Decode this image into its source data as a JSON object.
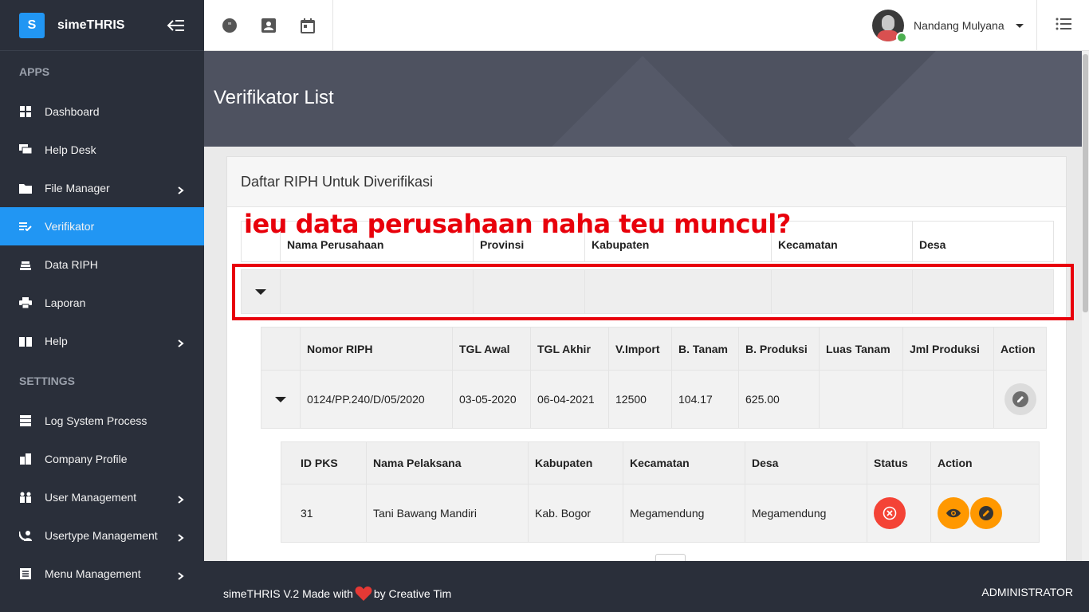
{
  "brand": {
    "logo_letter": "S",
    "name": "simeTHRIS"
  },
  "sidebar": {
    "section_apps": "APPS",
    "section_settings": "SETTINGS",
    "apps_items": [
      {
        "label": "Dashboard",
        "icon": "dashboard-icon"
      },
      {
        "label": "Help Desk",
        "icon": "chat-icon"
      },
      {
        "label": "File Manager",
        "icon": "folder-icon"
      },
      {
        "label": "Verifikator",
        "icon": "checklist-icon",
        "active": true
      },
      {
        "label": "Data RIPH",
        "icon": "stack-icon"
      },
      {
        "label": "Laporan",
        "icon": "print-icon"
      },
      {
        "label": "Help",
        "icon": "book-icon"
      }
    ],
    "settings_items": [
      {
        "label": "Log System Process",
        "icon": "storage-icon"
      },
      {
        "label": "Company Profile",
        "icon": "building-icon"
      },
      {
        "label": "User Management",
        "icon": "people-icon"
      },
      {
        "label": "Usertype Management",
        "icon": "phone-user-icon"
      },
      {
        "label": "Menu Management",
        "icon": "menu-list-icon"
      }
    ]
  },
  "topbar": {
    "user_name": "Nandang Mulyana"
  },
  "hero": {
    "title": "Verifikator List"
  },
  "card": {
    "title": "Daftar RIPH Untuk Diverifikasi",
    "outer_columns": [
      "Nama Perusahaan",
      "Provinsi",
      "Kabupaten",
      "Kecamatan",
      "Desa"
    ],
    "riph_columns": [
      "Nomor RIPH",
      "TGL Awal",
      "TGL Akhir",
      "V.Import",
      "B. Tanam",
      "B. Produksi",
      "Luas Tanam",
      "Jml Produksi",
      "Action"
    ],
    "riph_row": {
      "nomor": "0124/PP.240/D/05/2020",
      "tgl_awal": "03-05-2020",
      "tgl_akhir": "06-04-2021",
      "v_import": "12500",
      "b_tanam": "104.17",
      "b_produksi": "625.00",
      "luas_tanam": "",
      "jml_produksi": ""
    },
    "pks_columns": [
      "ID PKS",
      "Nama Pelaksana",
      "Kabupaten",
      "Kecamatan",
      "Desa",
      "Status",
      "Action"
    ],
    "pks_row": {
      "id": "31",
      "nama": "Tani Bawang Mandiri",
      "kabupaten": "Kab. Bogor",
      "kecamatan": "Megamendung",
      "desa": "Megamendung"
    }
  },
  "annotation": {
    "text": "ieu data perusahaan naha teu muncul?",
    "color": "#e8000b"
  },
  "footer": {
    "left_prefix": "simeTHRIS V.2 Made with",
    "left_suffix": "by Creative Tim",
    "right": "ADMINISTRATOR"
  },
  "colors": {
    "accent": "#2196f3",
    "sidebar_bg": "#2a2f3a",
    "danger": "#f44336",
    "warning": "#ff9800"
  }
}
